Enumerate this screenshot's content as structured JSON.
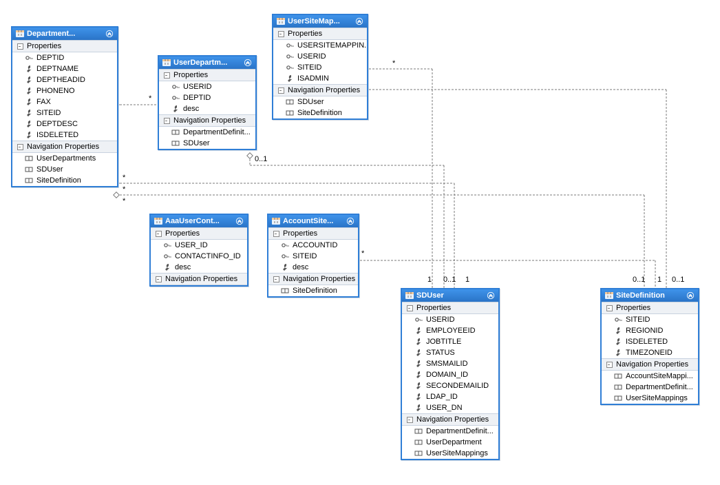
{
  "labels": {
    "properties": "Properties",
    "navprops": "Navigation Properties"
  },
  "entities": {
    "department": {
      "title": "Department...",
      "props": [
        "DEPTID",
        "DEPTNAME",
        "DEPTHEADID",
        "PHONENO",
        "FAX",
        "SITEID",
        "DEPTDESC",
        "ISDELETED"
      ],
      "nav": [
        "UserDepartments",
        "SDUser",
        "SiteDefinition"
      ]
    },
    "userdepartment": {
      "title": "UserDepartm...",
      "props": [
        "USERID",
        "DEPTID",
        "desc"
      ],
      "nav": [
        "DepartmentDefinit...",
        "SDUser"
      ]
    },
    "usersitemap": {
      "title": "UserSiteMap...",
      "props": [
        "USERSITEMAPPIN...",
        "USERID",
        "SITEID",
        "ISADMIN"
      ],
      "nav": [
        "SDUser",
        "SiteDefinition"
      ]
    },
    "aaausercont": {
      "title": "AaaUserCont...",
      "props": [
        "USER_ID",
        "CONTACTINFO_ID",
        "desc"
      ],
      "nav": []
    },
    "accountsite": {
      "title": "AccountSite...",
      "props": [
        "ACCOUNTID",
        "SITEID",
        "desc"
      ],
      "nav": [
        "SiteDefinition"
      ]
    },
    "sduser": {
      "title": "SDUser",
      "props": [
        "USERID",
        "EMPLOYEEID",
        "JOBTITLE",
        "STATUS",
        "SMSMAILID",
        "DOMAIN_ID",
        "SECONDEMAILID",
        "LDAP_ID",
        "USER_DN"
      ],
      "nav": [
        "DepartmentDefinit...",
        "UserDepartment",
        "UserSiteMappings"
      ]
    },
    "sitedefinition": {
      "title": "SiteDefinition",
      "props": [
        "SITEID",
        "REGIONID",
        "ISDELETED",
        "TIMEZONEID"
      ],
      "nav": [
        "AccountSiteMappi...",
        "DepartmentDefinit...",
        "UserSiteMappings"
      ]
    }
  },
  "mults": {
    "m1": "1",
    "m2": "*",
    "m3": "*",
    "m4": "0..1",
    "m5": "*",
    "m6": "*",
    "m7": "*",
    "m8": "*",
    "m9": "1",
    "m10": "0..1",
    "m11": "1",
    "m12": "0..1",
    "m13": "1",
    "m14": "0..1"
  }
}
